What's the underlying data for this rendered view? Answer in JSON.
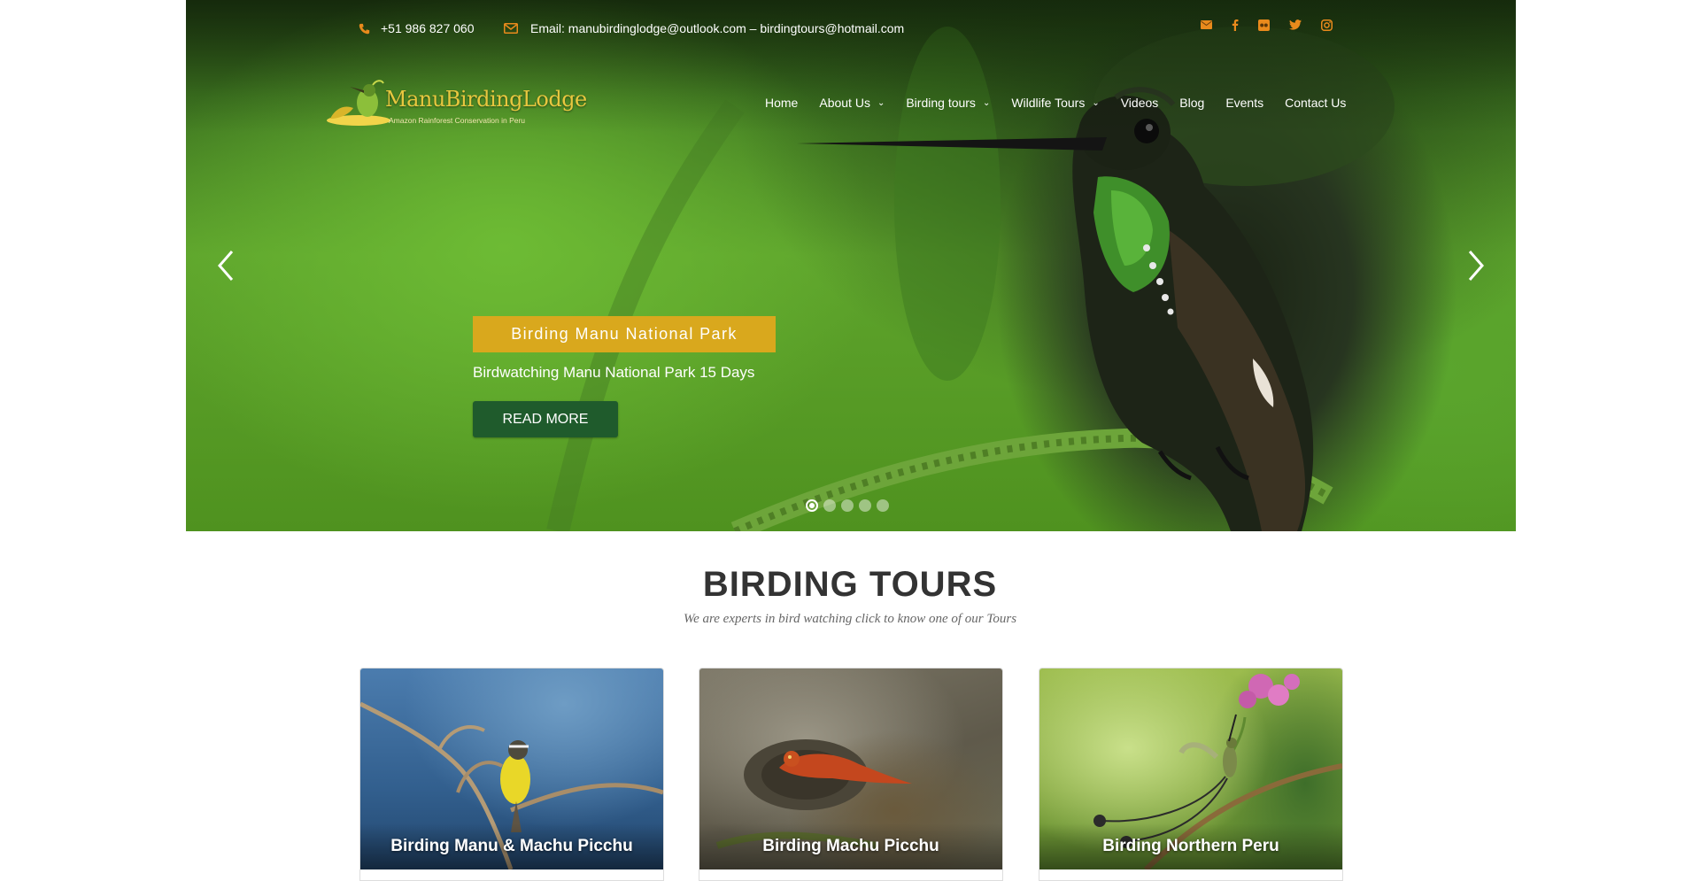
{
  "topbar": {
    "phone": "+51 986 827 060",
    "email": "Email: manubirdinglodge@outlook.com – birdingtours@hotmail.com",
    "social": [
      "envelope-icon",
      "facebook-icon",
      "flickr-icon",
      "twitter-icon",
      "instagram-icon"
    ],
    "accent_color": "#e98a1c"
  },
  "logo": {
    "name": "ManuBirdingLodge",
    "tagline": "Amazon Rainforest Conservation in Peru"
  },
  "nav": {
    "items": [
      {
        "label": "Home",
        "dropdown": false
      },
      {
        "label": "About Us",
        "dropdown": true
      },
      {
        "label": "Birding tours",
        "dropdown": true
      },
      {
        "label": "Wildlife Tours",
        "dropdown": true
      },
      {
        "label": "Videos",
        "dropdown": false
      },
      {
        "label": "Blog",
        "dropdown": false
      },
      {
        "label": "Events",
        "dropdown": false
      },
      {
        "label": "Contact Us",
        "dropdown": false
      }
    ]
  },
  "slider": {
    "title": "Birding Manu National Park",
    "subtitle": "Birdwatching Manu National Park 15 Days",
    "button": "READ MORE",
    "slide_count": 5,
    "active_slide": 1,
    "title_color": "#d9a81d",
    "button_color": "#1f5b2c"
  },
  "section": {
    "title": "BIRDING TOURS",
    "subtitle": "We are experts in bird watching click to know one of our Tours"
  },
  "cards": [
    {
      "label": "Birding Manu & Machu Picchu"
    },
    {
      "label": "Birding Machu Picchu"
    },
    {
      "label": "Birding Northern Peru"
    }
  ]
}
